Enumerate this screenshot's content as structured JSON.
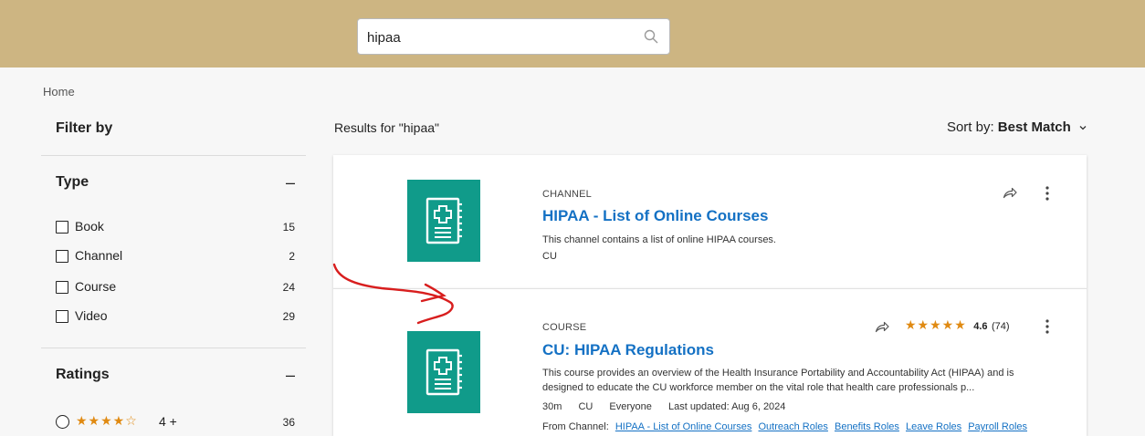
{
  "search": {
    "value": "hipaa"
  },
  "breadcrumb": "Home",
  "filters": {
    "title": "Filter by",
    "type": {
      "title": "Type",
      "collapse": "–",
      "options": [
        {
          "label": "Book",
          "count": "15"
        },
        {
          "label": "Channel",
          "count": "2"
        },
        {
          "label": "Course",
          "count": "24"
        },
        {
          "label": "Video",
          "count": "29"
        }
      ]
    },
    "ratings": {
      "title": "Ratings",
      "collapse": "–",
      "options": [
        {
          "stars": "★★★★☆",
          "label": "4 +",
          "count": "36"
        }
      ]
    }
  },
  "results": {
    "heading": "Results for \"hipaa\"",
    "sort_prefix": "Sort by:",
    "sort_value": "Best Match",
    "items": [
      {
        "type": "CHANNEL",
        "title": "HIPAA - List of Online Courses",
        "description": "This channel contains a list of online HIPAA courses.",
        "owner": "CU",
        "icon": "book-medical-icon"
      },
      {
        "type": "COURSE",
        "title": "CU: HIPAA Regulations",
        "description": "This course provides an overview of the Health Insurance Portability and Accountability Act (HIPAA) and is designed to educate the CU workforce member on the vital role that health care professionals p...",
        "duration": "30m",
        "owner": "CU",
        "audience": "Everyone",
        "updated": "Last updated: Aug 6, 2024",
        "rating_stars": "★★★★★",
        "rating_value": "4.6",
        "rating_count": "(74)",
        "from_channel_label": "From Channel:",
        "channels": [
          "HIPAA - List of Online Courses",
          "Outreach Roles",
          "Benefits Roles",
          "Leave Roles",
          "Payroll Roles"
        ],
        "icon": "book-medical-icon"
      }
    ]
  },
  "colors": {
    "header": "#cdb582",
    "thumb": "#109b8a",
    "link": "#1471c4",
    "star": "#e08a12",
    "annotation": "#d81e1e"
  }
}
